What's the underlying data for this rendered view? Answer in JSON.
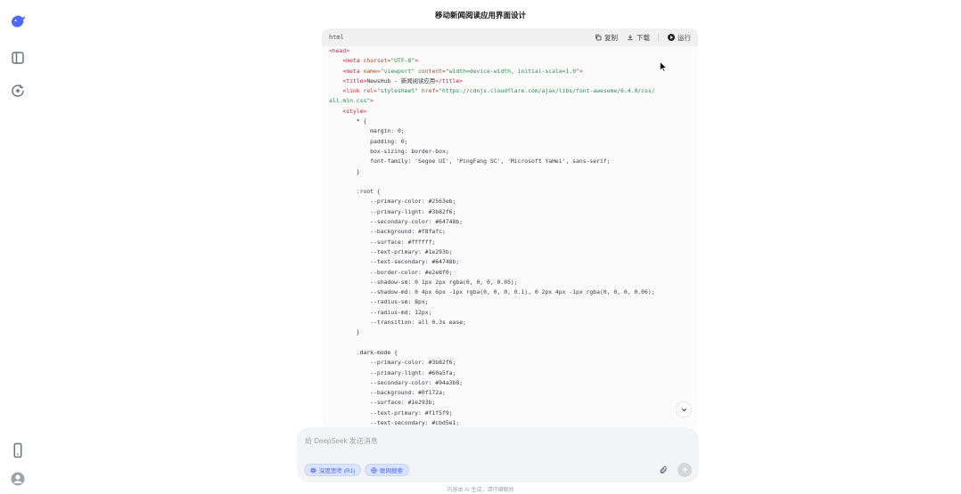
{
  "title": "移动新闻阅读应用界面设计",
  "sidebar": {
    "logo_icon": "deepseek-whale-icon",
    "toggle_icon": "sidebar-toggle-icon",
    "new_chat_icon": "new-chat-icon",
    "phone_icon": "mobile-app-icon",
    "avatar_icon": "user-avatar-icon"
  },
  "code_block": {
    "language": "html",
    "copy_label": "复制",
    "download_label": "下载",
    "run_label": "运行",
    "lines": [
      [
        {
          "c": "tag",
          "t": "<head>"
        }
      ],
      [
        {
          "c": "",
          "t": "    "
        },
        {
          "c": "tag",
          "t": "<meta"
        },
        {
          "c": "attr",
          "t": " charset="
        },
        {
          "c": "str",
          "t": "\"UTF-8\""
        },
        {
          "c": "tag",
          "t": ">"
        }
      ],
      [
        {
          "c": "",
          "t": "    "
        },
        {
          "c": "tag",
          "t": "<meta"
        },
        {
          "c": "attr",
          "t": " name="
        },
        {
          "c": "str",
          "t": "\"viewport\""
        },
        {
          "c": "attr",
          "t": " content="
        },
        {
          "c": "str",
          "t": "\"width=device-width, initial-scale=1.0\""
        },
        {
          "c": "tag",
          "t": ">"
        }
      ],
      [
        {
          "c": "",
          "t": "    "
        },
        {
          "c": "tag",
          "t": "<title>"
        },
        {
          "c": "",
          "t": "NewsHub - 新闻阅读应用"
        },
        {
          "c": "tag",
          "t": "</title>"
        }
      ],
      [
        {
          "c": "",
          "t": "    "
        },
        {
          "c": "tag",
          "t": "<link"
        },
        {
          "c": "attr",
          "t": " rel="
        },
        {
          "c": "str",
          "t": "\"stylesheet\""
        },
        {
          "c": "attr",
          "t": " href="
        },
        {
          "c": "str",
          "t": "\"https://cdnjs.cloudflare.com/ajax/libs/font-awesome/6.4.0/css/"
        }
      ],
      [
        {
          "c": "str",
          "t": "all.min.css\""
        },
        {
          "c": "tag",
          "t": ">"
        }
      ],
      [
        {
          "c": "",
          "t": "    "
        },
        {
          "c": "tag",
          "t": "<style>"
        }
      ],
      [
        {
          "c": "",
          "t": "        * {"
        }
      ],
      [
        {
          "c": "",
          "t": "            margin: 0;"
        }
      ],
      [
        {
          "c": "",
          "t": "            padding: 0;"
        }
      ],
      [
        {
          "c": "",
          "t": "            box-sizing: border-box;"
        }
      ],
      [
        {
          "c": "",
          "t": "            font-family: 'Segoe UI', 'PingFang SC', 'Microsoft YaHei', sans-serif;"
        }
      ],
      [
        {
          "c": "",
          "t": "        }"
        }
      ],
      [
        {
          "c": "",
          "t": ""
        }
      ],
      [
        {
          "c": "",
          "t": "        :root {"
        }
      ],
      [
        {
          "c": "",
          "t": "            --primary-color: #2563eb;"
        }
      ],
      [
        {
          "c": "",
          "t": "            --primary-light: #3b82f6;"
        }
      ],
      [
        {
          "c": "",
          "t": "            --secondary-color: #64748b;"
        }
      ],
      [
        {
          "c": "",
          "t": "            --background: #f8fafc;"
        }
      ],
      [
        {
          "c": "",
          "t": "            --surface: #ffffff;"
        }
      ],
      [
        {
          "c": "",
          "t": "            --text-primary: #1e293b;"
        }
      ],
      [
        {
          "c": "",
          "t": "            --text-secondary: #64748b;"
        }
      ],
      [
        {
          "c": "",
          "t": "            --border-color: #e2e8f0;"
        }
      ],
      [
        {
          "c": "",
          "t": "            --shadow-sm: 0 1px 2px rgba(0, 0, 0, 0.05);"
        }
      ],
      [
        {
          "c": "",
          "t": "            --shadow-md: 0 4px 6px -1px rgba(0, 0, 0, 0.1), 0 2px 4px -1px rgba(0, 0, 0, 0.06);"
        }
      ],
      [
        {
          "c": "",
          "t": "            --radius-sm: 8px;"
        }
      ],
      [
        {
          "c": "",
          "t": "            --radius-md: 12px;"
        }
      ],
      [
        {
          "c": "",
          "t": "            --transition: all 0.3s ease;"
        }
      ],
      [
        {
          "c": "",
          "t": "        }"
        }
      ],
      [
        {
          "c": "",
          "t": ""
        }
      ],
      [
        {
          "c": "",
          "t": "        .dark-mode {"
        }
      ],
      [
        {
          "c": "",
          "t": "            --primary-color: #3b82f6;"
        }
      ],
      [
        {
          "c": "",
          "t": "            --primary-light: #60a5fa;"
        }
      ],
      [
        {
          "c": "",
          "t": "            --secondary-color: #94a3b8;"
        }
      ],
      [
        {
          "c": "",
          "t": "            --background: #0f172a;"
        }
      ],
      [
        {
          "c": "",
          "t": "            --surface: #1e293b;"
        }
      ],
      [
        {
          "c": "",
          "t": "            --text-primary: #f1f5f9;"
        }
      ],
      [
        {
          "c": "",
          "t": "            --text-secondary: #cbd5e1;"
        }
      ]
    ]
  },
  "composer": {
    "placeholder": "给 DeepSeek 发送消息",
    "deep_think_label": "深度思考 (R1)",
    "web_search_label": "联网搜索"
  },
  "footer_note": "内容由 AI 生成，请仔细甄别",
  "colors": {
    "accent": "#4d6bfe",
    "tag": "#c9263f",
    "string": "#2e8b57"
  }
}
